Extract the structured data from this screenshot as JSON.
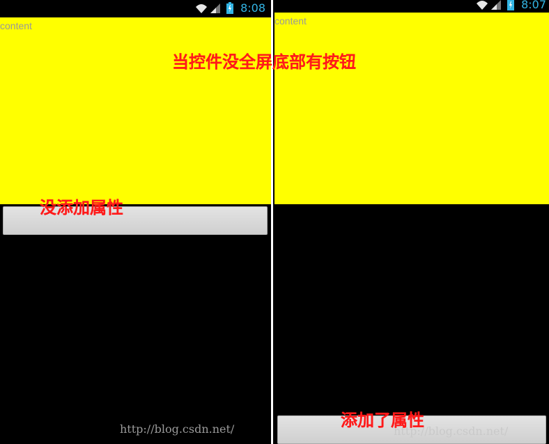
{
  "left_screen": {
    "status_bar": {
      "time": "8:08"
    },
    "content_label": "content",
    "annotation": "没添加属性",
    "watermark": "http://blog.csdn.net/"
  },
  "right_screen": {
    "status_bar": {
      "time": "8:07"
    },
    "content_label": "content",
    "annotation": "添加了属性",
    "watermark": "http://blog.csdn.net/"
  },
  "title_annotation": "当控件没全屏底部有按钮",
  "colors": {
    "content_background": "#ffff00",
    "screen_background": "#000000",
    "annotation_text": "#ff1a1a",
    "status_text": "#33b5e5"
  }
}
